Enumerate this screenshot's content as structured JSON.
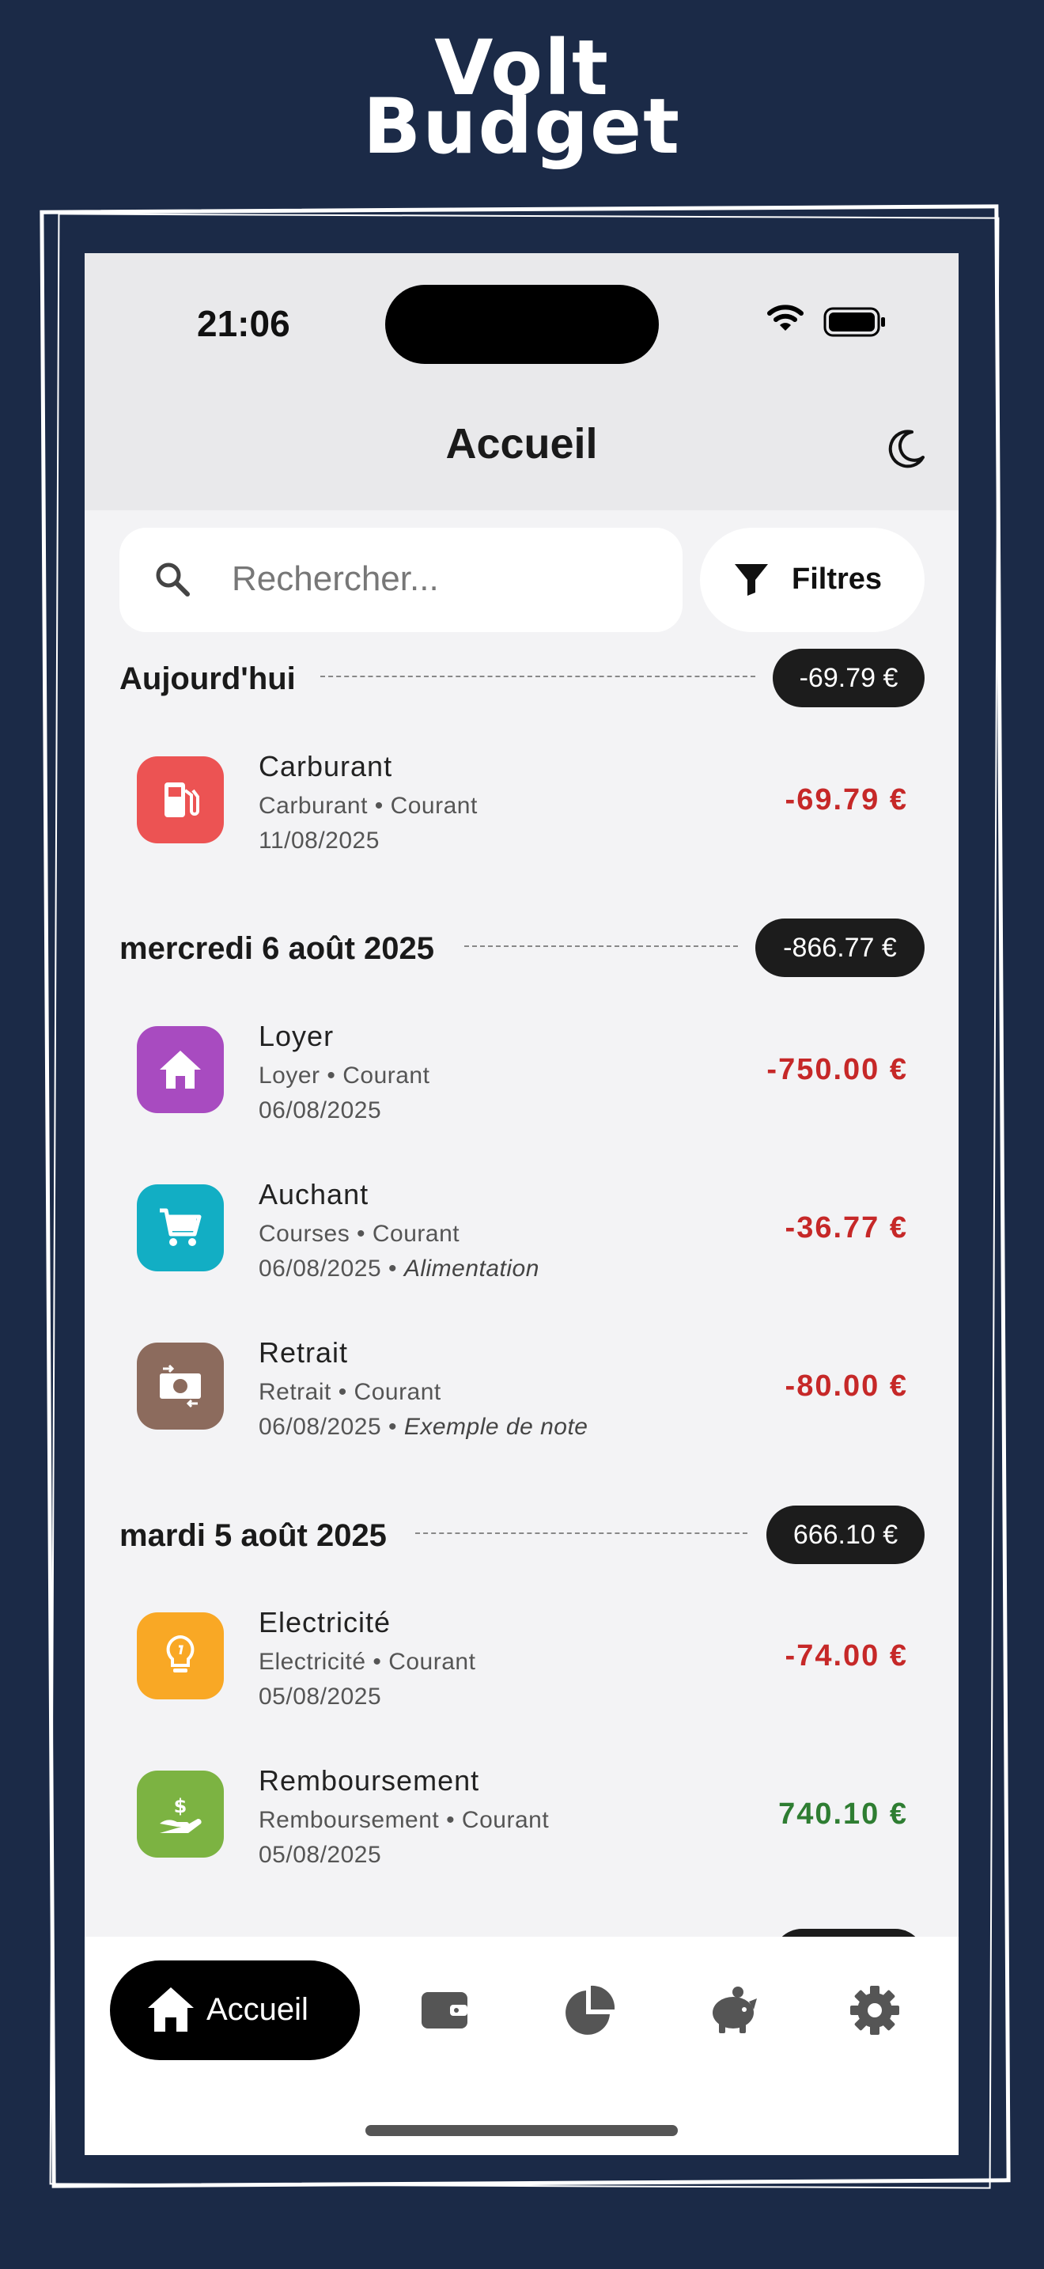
{
  "brand": {
    "line1": "Volt",
    "line2": "Budget"
  },
  "status_bar": {
    "time": "21:06"
  },
  "header": {
    "title": "Accueil",
    "theme_icon": "moon-icon"
  },
  "search": {
    "placeholder": "Rechercher...",
    "icon": "search-icon"
  },
  "filter": {
    "label": "Filtres",
    "icon": "filter-icon"
  },
  "sections": [
    {
      "title": "Aujourd'hui",
      "total": "-69.79 €",
      "transactions": [
        {
          "name": "Carburant",
          "sub": "Carburant • Courant",
          "date": "11/08/2025",
          "note": "",
          "amount": "-69.79 €",
          "icon": "fuel-pump-icon",
          "color": "#ec5353",
          "amount_color": "#c62828"
        }
      ]
    },
    {
      "title": "mercredi 6 août 2025",
      "total": "-866.77 €",
      "transactions": [
        {
          "name": "Loyer",
          "sub": "Loyer • Courant",
          "date": "06/08/2025",
          "note": "",
          "amount": "-750.00 €",
          "icon": "house-icon",
          "color": "#a84bc0",
          "amount_color": "#c62828"
        },
        {
          "name": "Auchant",
          "sub": "Courses • Courant",
          "date": "06/08/2025 • ",
          "note": "Alimentation",
          "amount": "-36.77 €",
          "icon": "cart-icon",
          "color": "#12aec4",
          "amount_color": "#c62828"
        },
        {
          "name": "Retrait",
          "sub": "Retrait • Courant",
          "date": "06/08/2025 • ",
          "note": "Exemple de note",
          "amount": "-80.00 €",
          "icon": "cash-exchange-icon",
          "color": "#8c6b5d",
          "amount_color": "#c62828"
        }
      ]
    },
    {
      "title": "mardi 5 août 2025",
      "total": "666.10 €",
      "transactions": [
        {
          "name": "Electricité",
          "sub": "Electricité • Courant",
          "date": "05/08/2025",
          "note": "",
          "amount": "-74.00 €",
          "icon": "lightbulb-icon",
          "color": "#f9a825",
          "amount_color": "#c62828"
        },
        {
          "name": "Remboursement",
          "sub": "Remboursement • Courant",
          "date": "05/08/2025",
          "note": "",
          "amount": "740.10 €",
          "icon": "hand-dollar-icon",
          "color": "#7cb342",
          "amount_color": "#2e7d32"
        }
      ]
    }
  ],
  "tabbar": {
    "active_label": "Accueil",
    "tabs": [
      "home-icon",
      "wallet-icon",
      "pie-chart-icon",
      "piggy-bank-icon",
      "gear-icon"
    ]
  }
}
